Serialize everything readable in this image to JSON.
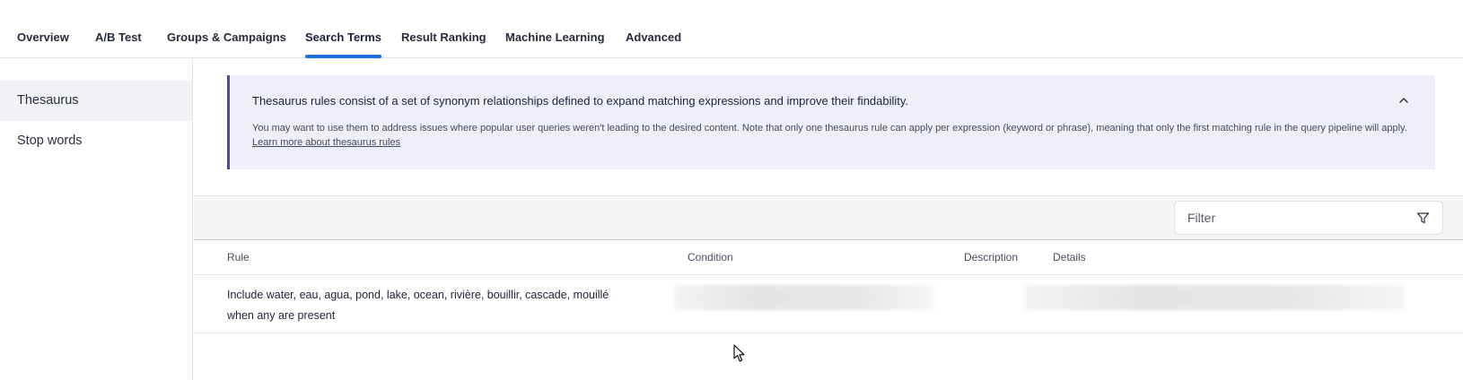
{
  "tabs": [
    {
      "label": "Overview",
      "active": false
    },
    {
      "label": "A/B Test",
      "active": false
    },
    {
      "label": "Groups & Campaigns",
      "active": false
    },
    {
      "label": "Search Terms",
      "active": true
    },
    {
      "label": "Result Ranking",
      "active": false
    },
    {
      "label": "Machine Learning",
      "active": false
    },
    {
      "label": "Advanced",
      "active": false
    }
  ],
  "sidebar": {
    "items": [
      {
        "label": "Thesaurus",
        "active": true
      },
      {
        "label": "Stop words",
        "active": false
      }
    ]
  },
  "banner": {
    "title": "Thesaurus rules consist of a set of synonym relationships defined to expand matching expressions and improve their findability.",
    "body": "You may want to use them to address issues where popular user queries weren't leading to the desired content. Note that only one thesaurus rule can apply per expression (keyword or phrase), meaning that only the first matching rule in the query pipeline will apply.",
    "link": "Learn more about thesaurus rules",
    "chevron_icon": "chevron-up-icon",
    "accent_color": "#4c4a9c",
    "background_color": "#efeffc"
  },
  "filter": {
    "placeholder": "Filter",
    "icon": "filter-funnel-icon"
  },
  "table": {
    "columns": [
      "Rule",
      "Condition",
      "Description",
      "Details"
    ],
    "rows": [
      {
        "rule": "Include water, eau, agua, pond, lake, ocean, rivière, bouillir, cascade, mouillé when any are present"
      }
    ]
  },
  "colors": {
    "active_tab_underline": "#1b6fe3"
  }
}
